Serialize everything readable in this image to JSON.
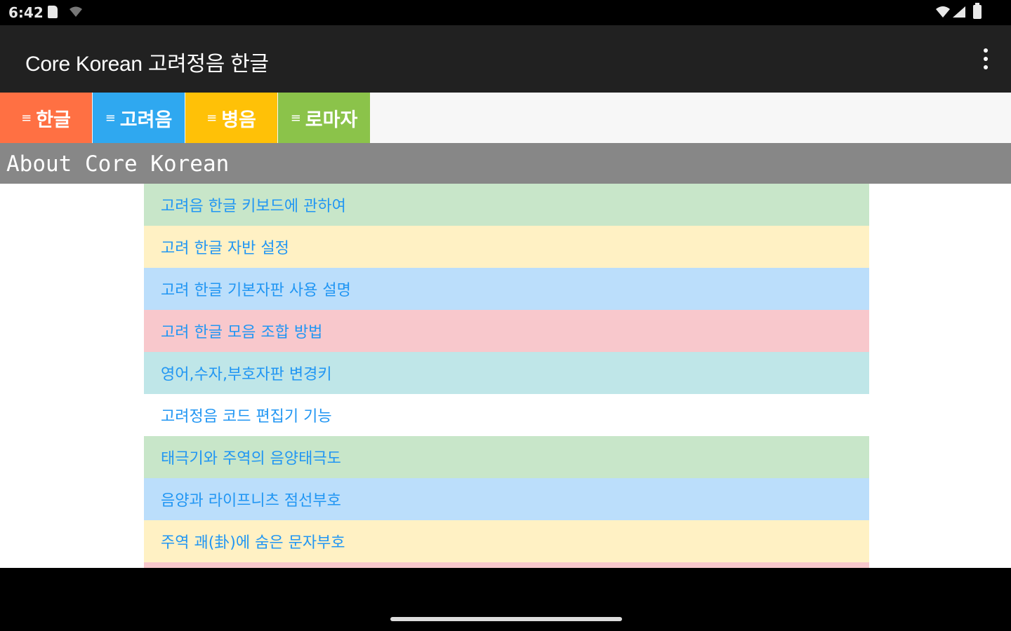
{
  "status_bar": {
    "time": "6:42"
  },
  "app_bar": {
    "title": "Core Korean 고려정음 한글"
  },
  "tabs": [
    {
      "label": "한글",
      "color": "#ff7043"
    },
    {
      "label": "고려음",
      "color": "#2fa8f0"
    },
    {
      "label": "병음",
      "color": "#ffc107"
    },
    {
      "label": "로마자",
      "color": "#8bc34a"
    }
  ],
  "section": {
    "title": "About Core Korean"
  },
  "list_items": [
    {
      "label": "고려음 한글 키보드에 관하여",
      "color": "#c8e6c9"
    },
    {
      "label": "고려 한글 자반 설정",
      "color": "#fff1c4"
    },
    {
      "label": "고려 한글 기본자판 사용 설명",
      "color": "#bbdefb"
    },
    {
      "label": "고려 한글 모음 조합 방법",
      "color": "#f8c8cc"
    },
    {
      "label": "영어,수자,부호자판 변경키",
      "color": "#bfe6e8"
    },
    {
      "label": "고려정음 코드 편집기 기능",
      "color": "#ffffff"
    },
    {
      "label": "태극기와 주역의 음양태극도",
      "color": "#c8e6c9"
    },
    {
      "label": "음양과 라이프니츠 점선부호",
      "color": "#bbdefb"
    },
    {
      "label": "주역 괘(卦)에 숨은 문자부호",
      "color": "#fff1c4"
    },
    {
      "label": "",
      "color": "#f8c8cc"
    }
  ]
}
